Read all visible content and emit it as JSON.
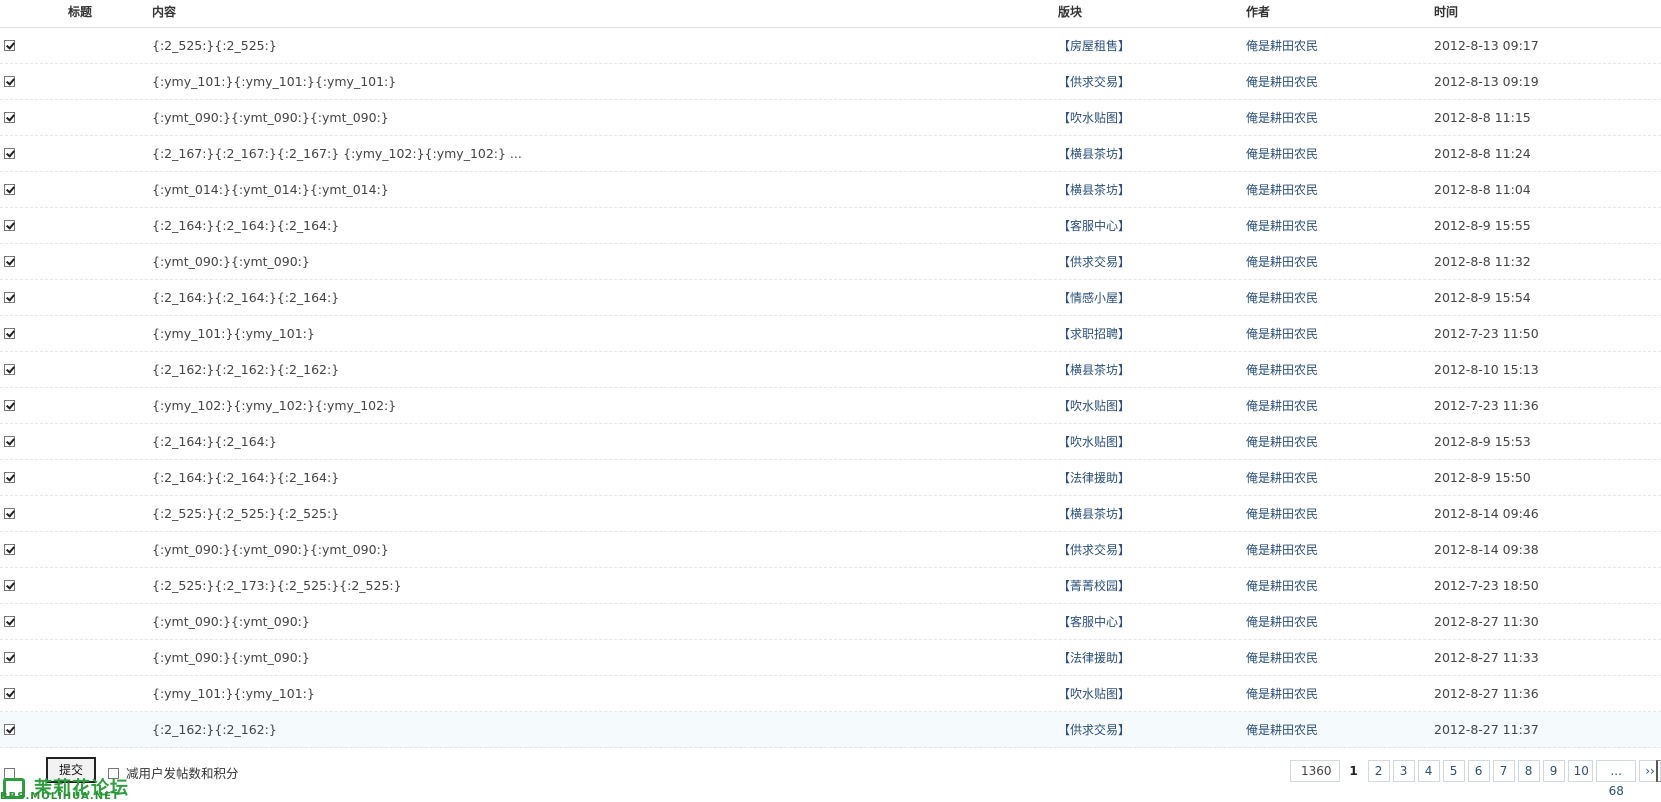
{
  "header": {
    "title": "标题",
    "content": "内容",
    "board": "版块",
    "author": "作者",
    "time": "时间"
  },
  "rows": [
    {
      "content": "{:2_525:}{:2_525:}",
      "board": "【房屋租售】",
      "author": "俺是耕田农民",
      "time": "2012-8-13 09:17"
    },
    {
      "content": "{:ymy_101:}{:ymy_101:}{:ymy_101:}",
      "board": "【供求交易】",
      "author": "俺是耕田农民",
      "time": "2012-8-13 09:19"
    },
    {
      "content": "{:ymt_090:}{:ymt_090:}{:ymt_090:}",
      "board": "【吹水贴图】",
      "author": "俺是耕田农民",
      "time": "2012-8-8 11:15"
    },
    {
      "content": "{:2_167:}{:2_167:}{:2_167:} {:ymy_102:}{:ymy_102:} ...",
      "board": "【横县茶坊】",
      "author": "俺是耕田农民",
      "time": "2012-8-8 11:24"
    },
    {
      "content": "{:ymt_014:}{:ymt_014:}{:ymt_014:}",
      "board": "【横县茶坊】",
      "author": "俺是耕田农民",
      "time": "2012-8-8 11:04"
    },
    {
      "content": "{:2_164:}{:2_164:}{:2_164:}",
      "board": "【客服中心】",
      "author": "俺是耕田农民",
      "time": "2012-8-9 15:55"
    },
    {
      "content": "{:ymt_090:}{:ymt_090:}",
      "board": "【供求交易】",
      "author": "俺是耕田农民",
      "time": "2012-8-8 11:32"
    },
    {
      "content": "{:2_164:}{:2_164:}{:2_164:}",
      "board": "【情感小屋】",
      "author": "俺是耕田农民",
      "time": "2012-8-9 15:54"
    },
    {
      "content": "{:ymy_101:}{:ymy_101:}",
      "board": "【求职招聘】",
      "author": "俺是耕田农民",
      "time": "2012-7-23 11:50"
    },
    {
      "content": "{:2_162:}{:2_162:}{:2_162:}",
      "board": "【横县茶坊】",
      "author": "俺是耕田农民",
      "time": "2012-8-10 15:13"
    },
    {
      "content": "{:ymy_102:}{:ymy_102:}{:ymy_102:}",
      "board": "【吹水贴图】",
      "author": "俺是耕田农民",
      "time": "2012-7-23 11:36"
    },
    {
      "content": "{:2_164:}{:2_164:}",
      "board": "【吹水贴图】",
      "author": "俺是耕田农民",
      "time": "2012-8-9 15:53"
    },
    {
      "content": "{:2_164:}{:2_164:}{:2_164:}",
      "board": "【法律援助】",
      "author": "俺是耕田农民",
      "time": "2012-8-9 15:50"
    },
    {
      "content": "{:2_525:}{:2_525:}{:2_525:}",
      "board": "【横县茶坊】",
      "author": "俺是耕田农民",
      "time": "2012-8-14 09:46"
    },
    {
      "content": "{:ymt_090:}{:ymt_090:}{:ymt_090:}",
      "board": "【供求交易】",
      "author": "俺是耕田农民",
      "time": "2012-8-14 09:38"
    },
    {
      "content": "{:2_525:}{:2_173:}{:2_525:}{:2_525:}",
      "board": "【菁菁校园】",
      "author": "俺是耕田农民",
      "time": "2012-7-23 18:50"
    },
    {
      "content": "{:ymt_090:}{:ymt_090:}",
      "board": "【客服中心】",
      "author": "俺是耕田农民",
      "time": "2012-8-27 11:30"
    },
    {
      "content": "{:ymt_090:}{:ymt_090:}",
      "board": "【法律援助】",
      "author": "俺是耕田农民",
      "time": "2012-8-27 11:33"
    },
    {
      "content": "{:ymy_101:}{:ymy_101:}",
      "board": "【吹水贴图】",
      "author": "俺是耕田农民",
      "time": "2012-8-27 11:36"
    },
    {
      "content": "{:2_162:}{:2_162:}",
      "board": "【供求交易】",
      "author": "俺是耕田农民",
      "time": "2012-8-27 11:37"
    }
  ],
  "footer": {
    "submit_label": "提交",
    "deduct_label": "减用户发帖数和积分",
    "logo_text": "茉莉花论坛",
    "logo_url": "BBS.MOLIHUA.NET"
  },
  "pagination": {
    "total": "1360",
    "current": "1",
    "pages": [
      "2",
      "3",
      "4",
      "5",
      "6",
      "7",
      "8",
      "9",
      "10",
      "... 68"
    ],
    "next": "››"
  },
  "colors": {
    "link": "#2b4f7a",
    "logo_green": "#2e9e3e"
  }
}
